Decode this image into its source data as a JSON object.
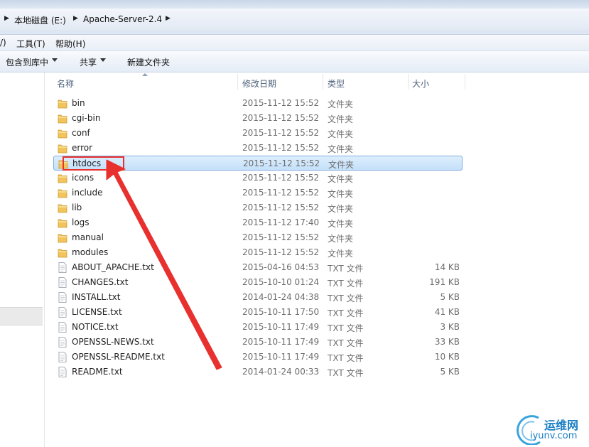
{
  "breadcrumb": {
    "items": [
      "本地磁盘 (E:)",
      "Apache-Server-2.4"
    ]
  },
  "menubar": {
    "partial": "/)",
    "tools": "工具(T)",
    "help": "帮助(H)"
  },
  "toolbar": {
    "include_in_library": "包含到库中",
    "share": "共享",
    "new_folder": "新建文件夹"
  },
  "columns": {
    "name": "名称",
    "modified": "修改日期",
    "type": "类型",
    "size": "大小"
  },
  "files": [
    {
      "name": "bin",
      "modified": "2015-11-12 15:52",
      "type": "文件夹",
      "size": "",
      "icon": "folder-icon"
    },
    {
      "name": "cgi-bin",
      "modified": "2015-11-12 15:52",
      "type": "文件夹",
      "size": "",
      "icon": "folder-icon"
    },
    {
      "name": "conf",
      "modified": "2015-11-12 15:52",
      "type": "文件夹",
      "size": "",
      "icon": "folder-icon"
    },
    {
      "name": "error",
      "modified": "2015-11-12 15:52",
      "type": "文件夹",
      "size": "",
      "icon": "folder-icon"
    },
    {
      "name": "htdocs",
      "modified": "2015-11-12 15:52",
      "type": "文件夹",
      "size": "",
      "icon": "folder-icon",
      "selected": true
    },
    {
      "name": "icons",
      "modified": "2015-11-12 15:52",
      "type": "文件夹",
      "size": "",
      "icon": "folder-icon"
    },
    {
      "name": "include",
      "modified": "2015-11-12 15:52",
      "type": "文件夹",
      "size": "",
      "icon": "folder-icon"
    },
    {
      "name": "lib",
      "modified": "2015-11-12 15:52",
      "type": "文件夹",
      "size": "",
      "icon": "folder-icon"
    },
    {
      "name": "logs",
      "modified": "2015-11-12 17:40",
      "type": "文件夹",
      "size": "",
      "icon": "folder-icon"
    },
    {
      "name": "manual",
      "modified": "2015-11-12 15:52",
      "type": "文件夹",
      "size": "",
      "icon": "folder-icon"
    },
    {
      "name": "modules",
      "modified": "2015-11-12 15:52",
      "type": "文件夹",
      "size": "",
      "icon": "folder-icon"
    },
    {
      "name": "ABOUT_APACHE.txt",
      "modified": "2015-04-16 04:53",
      "type": "TXT 文件",
      "size": "14 KB",
      "icon": "text-file-icon"
    },
    {
      "name": "CHANGES.txt",
      "modified": "2015-10-10 01:24",
      "type": "TXT 文件",
      "size": "191 KB",
      "icon": "text-file-icon"
    },
    {
      "name": "INSTALL.txt",
      "modified": "2014-01-24 04:38",
      "type": "TXT 文件",
      "size": "5 KB",
      "icon": "text-file-icon"
    },
    {
      "name": "LICENSE.txt",
      "modified": "2015-10-11 17:50",
      "type": "TXT 文件",
      "size": "41 KB",
      "icon": "text-file-icon"
    },
    {
      "name": "NOTICE.txt",
      "modified": "2015-10-11 17:49",
      "type": "TXT 文件",
      "size": "3 KB",
      "icon": "text-file-icon"
    },
    {
      "name": "OPENSSL-NEWS.txt",
      "modified": "2015-10-11 17:49",
      "type": "TXT 文件",
      "size": "33 KB",
      "icon": "text-file-icon"
    },
    {
      "name": "OPENSSL-README.txt",
      "modified": "2015-10-11 17:49",
      "type": "TXT 文件",
      "size": "10 KB",
      "icon": "text-file-icon"
    },
    {
      "name": "README.txt",
      "modified": "2014-01-24 00:33",
      "type": "TXT 文件",
      "size": "5 KB",
      "icon": "text-file-icon"
    }
  ],
  "annotation": {
    "color": "#e8302f",
    "highlighted_item": "htdocs"
  },
  "watermark": {
    "cn": "运维网",
    "en": "iyunv.com"
  },
  "colors": {
    "selection": "#cce4fb",
    "folder": "#f2c55c",
    "watermark": "#1a7fc4"
  }
}
